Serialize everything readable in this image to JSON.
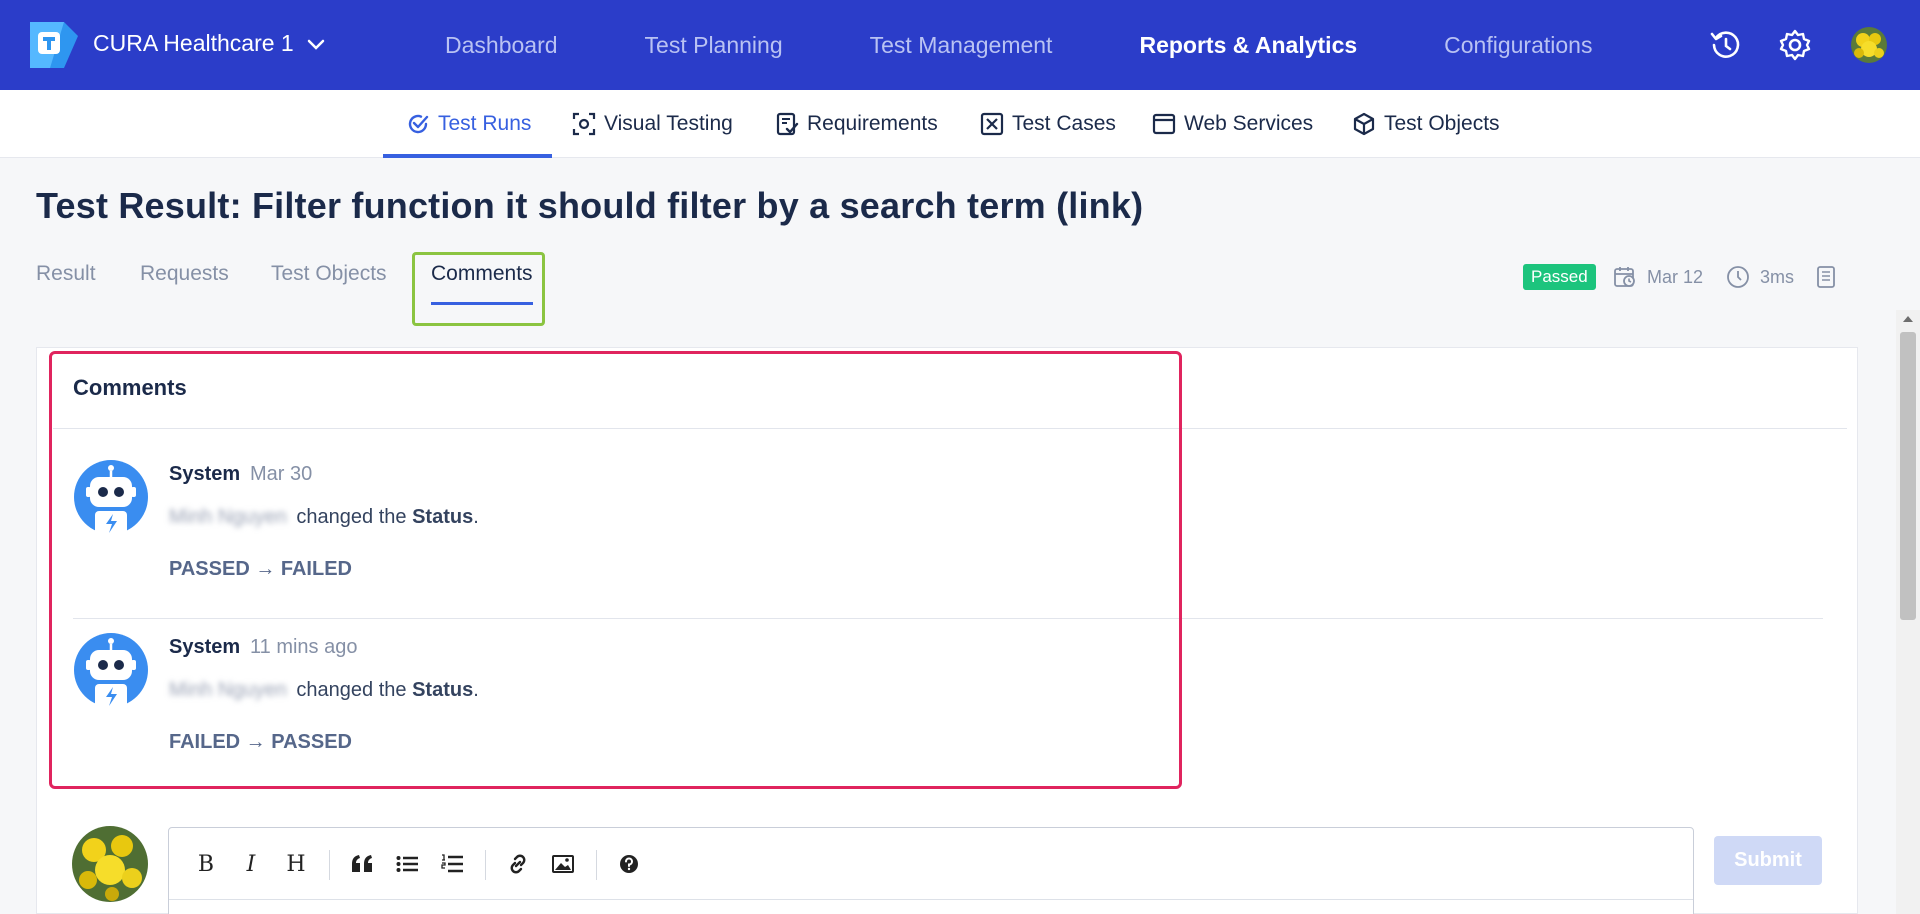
{
  "header": {
    "project_name": "CURA Healthcare 1",
    "nav": [
      {
        "label": "Dashboard",
        "active": false
      },
      {
        "label": "Test Planning",
        "active": false
      },
      {
        "label": "Test Management",
        "active": false
      },
      {
        "label": "Reports & Analytics",
        "active": true
      },
      {
        "label": "Configurations",
        "active": false
      }
    ],
    "icons": [
      "history-icon",
      "gear-icon",
      "avatar"
    ]
  },
  "subnav": [
    {
      "label": "Test Runs",
      "icon": "check-circle-icon",
      "active": true
    },
    {
      "label": "Visual Testing",
      "icon": "camera-focus-icon",
      "active": false
    },
    {
      "label": "Requirements",
      "icon": "requirements-icon",
      "active": false
    },
    {
      "label": "Test Cases",
      "icon": "test-case-icon",
      "active": false
    },
    {
      "label": "Web Services",
      "icon": "browser-window-icon",
      "active": false
    },
    {
      "label": "Test Objects",
      "icon": "cube-icon",
      "active": false
    }
  ],
  "page": {
    "title": "Test Result: Filter function it should filter by a search term (link)",
    "tabs": [
      {
        "label": "Result",
        "active": false
      },
      {
        "label": "Requests",
        "active": false
      },
      {
        "label": "Test Objects",
        "active": false
      },
      {
        "label": "Comments",
        "active": true
      }
    ],
    "status_badge": "Passed",
    "date": "Mar 12",
    "duration": "3ms",
    "status_color": "#1cc47d",
    "accent_color": "#3760e0"
  },
  "comments_panel": {
    "title": "Comments",
    "comments": [
      {
        "author": "System",
        "date": "Mar 30",
        "user": "Minh Nguyen",
        "text_before": "changed the",
        "field": "Status",
        "text_after": ".",
        "change": "PASSED → FAILED"
      },
      {
        "author": "System",
        "date": "11 mins ago",
        "user": "Minh Nguyen",
        "text_before": "changed the",
        "field": "Status",
        "text_after": ".",
        "change": "FAILED → PASSED"
      }
    ]
  },
  "editor": {
    "toolbar": {
      "bold": "B",
      "italic": "I",
      "heading": "H"
    },
    "submit_label": "Submit"
  }
}
